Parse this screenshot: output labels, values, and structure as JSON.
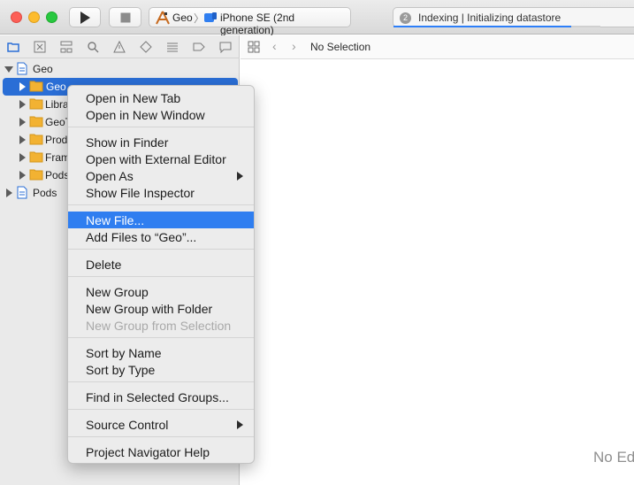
{
  "toolbar": {
    "scheme": {
      "project": "Geo",
      "separator": "〉",
      "device": "iPhone SE (2nd generation)"
    },
    "activity": {
      "badge": "2",
      "status": "Indexing | Initializing datastore",
      "progress": 0.86
    }
  },
  "navigator": {
    "tabs": [
      "folder-icon",
      "x-square-icon",
      "hierarchy-icon",
      "search-icon",
      "warning-icon",
      "diamond-icon",
      "list-icon",
      "tag-icon",
      "message-icon"
    ],
    "tree": [
      {
        "label": "Geo",
        "icon": "project-icon",
        "expanded": true,
        "selected": false
      },
      {
        "label": "Geo",
        "icon": "folder-icon",
        "expanded": false,
        "selected": true
      },
      {
        "label": "Libra",
        "icon": "folder-icon",
        "expanded": false,
        "selected": false
      },
      {
        "label": "GeoT",
        "icon": "folder-icon",
        "expanded": false,
        "selected": false
      },
      {
        "label": "Prod",
        "icon": "folder-icon",
        "expanded": false,
        "selected": false
      },
      {
        "label": "Fram",
        "icon": "folder-icon",
        "expanded": false,
        "selected": false
      },
      {
        "label": "Pods",
        "icon": "folder-icon",
        "expanded": false,
        "selected": false
      },
      {
        "label": "Pods",
        "icon": "project-icon",
        "expanded": false,
        "selected": false
      }
    ]
  },
  "editor": {
    "jumpbar": {
      "title": "No Selection"
    },
    "placeholder": "No Ed"
  },
  "context_menu": {
    "items": [
      {
        "label": "Open in New Tab"
      },
      {
        "label": "Open in New Window"
      },
      {
        "label": "Show in Finder"
      },
      {
        "label": "Open with External Editor"
      },
      {
        "label": "Open As"
      },
      {
        "label": "Show File Inspector"
      },
      {
        "label": "New File..."
      },
      {
        "label": "Add Files to “Geo”..."
      },
      {
        "label": "Delete"
      },
      {
        "label": "New Group"
      },
      {
        "label": "New Group with Folder"
      },
      {
        "label": "New Group from Selection"
      },
      {
        "label": "Sort by Name"
      },
      {
        "label": "Sort by Type"
      },
      {
        "label": "Find in Selected Groups..."
      },
      {
        "label": "Source Control"
      },
      {
        "label": "Project Navigator Help"
      }
    ],
    "highlighted": "New File...",
    "disabled": [
      "New Group from Selection"
    ],
    "submenus": [
      "Open As",
      "Source Control"
    ]
  },
  "colors": {
    "accent": "#2f7ef0",
    "selection": "#2a6ed6",
    "folder": "#f2b232"
  }
}
